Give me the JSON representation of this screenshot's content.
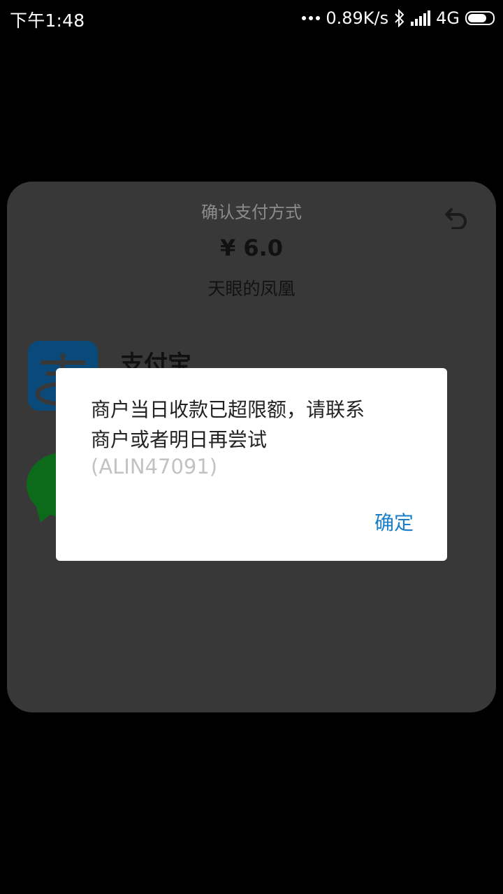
{
  "status_bar": {
    "time": "下午1:48",
    "network_speed": "0.89K/s",
    "network_type": "4G",
    "icons": [
      "dots-icon",
      "bluetooth-icon",
      "signal-icon",
      "battery-icon"
    ]
  },
  "sheet": {
    "title": "确认支付方式",
    "amount": "¥ 6.0",
    "merchant": "天眼的凤凰",
    "methods": [
      {
        "label": "支付宝",
        "icon": "alipay-icon"
      },
      {
        "label": "",
        "icon": "wechat-icon"
      }
    ]
  },
  "dialog": {
    "message": "商户当日收款已超限额，请联系商户或者明日再尝试",
    "code": "(ALIN47091)",
    "confirm_label": "确定"
  },
  "colors": {
    "background": "#000000",
    "sheet": "#383838",
    "dialog": "#ffffff",
    "accent": "#1a7ec8",
    "alipay_blue": "#0a4a7a",
    "wechat_green": "#0e6a1b"
  }
}
